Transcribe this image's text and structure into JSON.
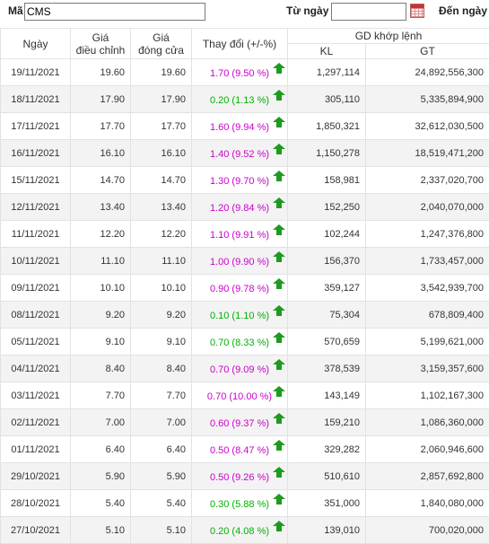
{
  "search": {
    "ma_label": "Mã",
    "ma_value": "CMS",
    "tu_ngay_label": "Từ ngày",
    "tu_ngay_value": "",
    "den_ngay_label": "Đến ngày",
    "calendar_icon": "calendar-icon"
  },
  "table": {
    "headers": {
      "date": "Ngày",
      "adj_price_1": "Giá",
      "adj_price_2": "điều chỉnh",
      "close_price_1": "Giá",
      "close_price_2": "đóng cửa",
      "change": "Thay đổi (+/-%)",
      "gd_group": "GD khớp lệnh",
      "kl": "KL",
      "gt": "GT"
    },
    "up_icon": "arrow-up-icon",
    "colors": {
      "purple": "#cc00cc",
      "green": "#00b100",
      "arrow": "#1e9b1e"
    },
    "rows": [
      {
        "date": "19/11/2021",
        "adj": "19.60",
        "close": "19.60",
        "change": "1.70 (9.50 %)",
        "color": "purple",
        "kl": "1,297,114",
        "gt": "24,892,556,300"
      },
      {
        "date": "18/11/2021",
        "adj": "17.90",
        "close": "17.90",
        "change": "0.20 (1.13 %)",
        "color": "green",
        "kl": "305,110",
        "gt": "5,335,894,900"
      },
      {
        "date": "17/11/2021",
        "adj": "17.70",
        "close": "17.70",
        "change": "1.60 (9.94 %)",
        "color": "purple",
        "kl": "1,850,321",
        "gt": "32,612,030,500"
      },
      {
        "date": "16/11/2021",
        "adj": "16.10",
        "close": "16.10",
        "change": "1.40 (9.52 %)",
        "color": "purple",
        "kl": "1,150,278",
        "gt": "18,519,471,200"
      },
      {
        "date": "15/11/2021",
        "adj": "14.70",
        "close": "14.70",
        "change": "1.30 (9.70 %)",
        "color": "purple",
        "kl": "158,981",
        "gt": "2,337,020,700"
      },
      {
        "date": "12/11/2021",
        "adj": "13.40",
        "close": "13.40",
        "change": "1.20 (9.84 %)",
        "color": "purple",
        "kl": "152,250",
        "gt": "2,040,070,000"
      },
      {
        "date": "11/11/2021",
        "adj": "12.20",
        "close": "12.20",
        "change": "1.10 (9.91 %)",
        "color": "purple",
        "kl": "102,244",
        "gt": "1,247,376,800"
      },
      {
        "date": "10/11/2021",
        "adj": "11.10",
        "close": "11.10",
        "change": "1.00 (9.90 %)",
        "color": "purple",
        "kl": "156,370",
        "gt": "1,733,457,000"
      },
      {
        "date": "09/11/2021",
        "adj": "10.10",
        "close": "10.10",
        "change": "0.90 (9.78 %)",
        "color": "purple",
        "kl": "359,127",
        "gt": "3,542,939,700"
      },
      {
        "date": "08/11/2021",
        "adj": "9.20",
        "close": "9.20",
        "change": "0.10 (1.10 %)",
        "color": "green",
        "kl": "75,304",
        "gt": "678,809,400"
      },
      {
        "date": "05/11/2021",
        "adj": "9.10",
        "close": "9.10",
        "change": "0.70 (8.33 %)",
        "color": "green",
        "kl": "570,659",
        "gt": "5,199,621,000"
      },
      {
        "date": "04/11/2021",
        "adj": "8.40",
        "close": "8.40",
        "change": "0.70 (9.09 %)",
        "color": "purple",
        "kl": "378,539",
        "gt": "3,159,357,600"
      },
      {
        "date": "03/11/2021",
        "adj": "7.70",
        "close": "7.70",
        "change": "0.70 (10.00 %)",
        "color": "purple",
        "kl": "143,149",
        "gt": "1,102,167,300"
      },
      {
        "date": "02/11/2021",
        "adj": "7.00",
        "close": "7.00",
        "change": "0.60 (9.37 %)",
        "color": "purple",
        "kl": "159,210",
        "gt": "1,086,360,000"
      },
      {
        "date": "01/11/2021",
        "adj": "6.40",
        "close": "6.40",
        "change": "0.50 (8.47 %)",
        "color": "purple",
        "kl": "329,282",
        "gt": "2,060,946,600"
      },
      {
        "date": "29/10/2021",
        "adj": "5.90",
        "close": "5.90",
        "change": "0.50 (9.26 %)",
        "color": "purple",
        "kl": "510,610",
        "gt": "2,857,692,800"
      },
      {
        "date": "28/10/2021",
        "adj": "5.40",
        "close": "5.40",
        "change": "0.30 (5.88 %)",
        "color": "green",
        "kl": "351,000",
        "gt": "1,840,080,000"
      },
      {
        "date": "27/10/2021",
        "adj": "5.10",
        "close": "5.10",
        "change": "0.20 (4.08 %)",
        "color": "green",
        "kl": "139,010",
        "gt": "700,020,000"
      }
    ]
  }
}
